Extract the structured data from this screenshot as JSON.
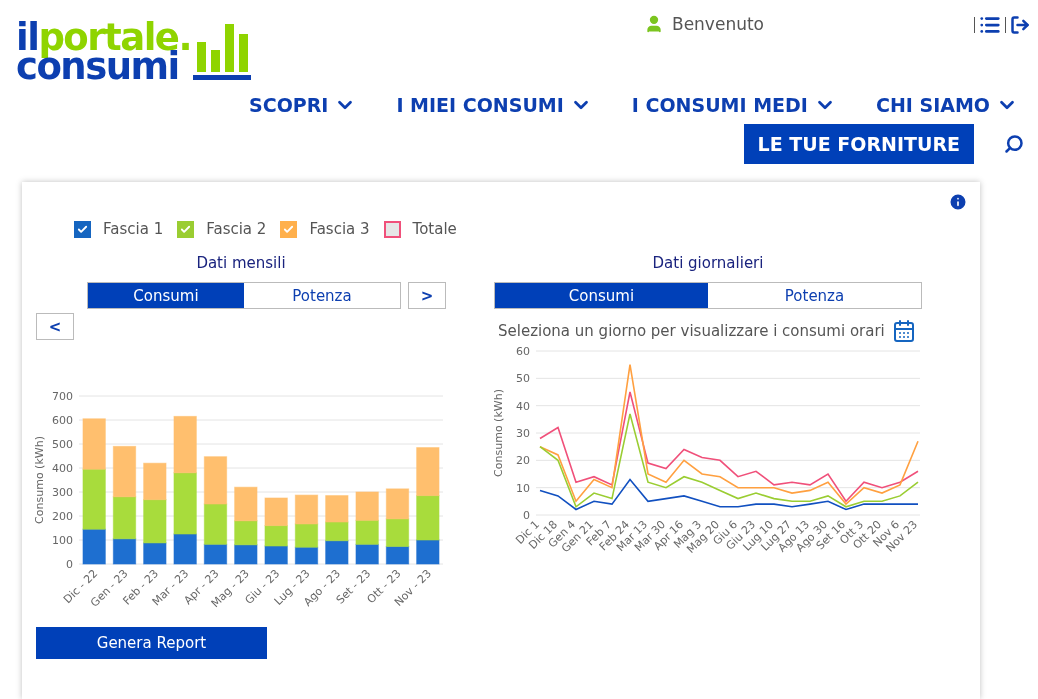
{
  "logo": {
    "part1": "il",
    "part2": "portale.",
    "part3": "consumi"
  },
  "user": {
    "greeting": "Benvenuto"
  },
  "nav": [
    {
      "label": "SCOPRI"
    },
    {
      "label": "I MIEI CONSUMI"
    },
    {
      "label": "I CONSUMI MEDI"
    },
    {
      "label": "CHI SIAMO"
    }
  ],
  "supply_button": "LE TUE FORNITURE",
  "legend": [
    {
      "label": "Fascia 1",
      "checked": true,
      "color": "#1565c0"
    },
    {
      "label": "Fascia 2",
      "checked": true,
      "color": "#9acd32"
    },
    {
      "label": "Fascia 3",
      "checked": true,
      "color": "#ffb04c"
    },
    {
      "label": "Totale",
      "checked": false,
      "color": "#f0507a"
    }
  ],
  "monthly": {
    "title": "Dati mensili",
    "prev": "<",
    "next": ">",
    "tabs": [
      {
        "label": "Consumi",
        "selected": true
      },
      {
        "label": "Potenza",
        "selected": false
      }
    ],
    "chart_data": {
      "type": "bar",
      "stacked": true,
      "grid": true,
      "ylabel": "Consumo (kWh)",
      "ylim": [
        0,
        700
      ],
      "yticks": [
        0,
        100,
        200,
        300,
        400,
        500,
        600,
        700
      ],
      "categories": [
        "Dic - 22",
        "Gen - 23",
        "Feb - 23",
        "Mar - 23",
        "Apr - 23",
        "Mag - 23",
        "Giu - 23",
        "Lug - 23",
        "Ago - 23",
        "Set - 23",
        "Ott - 23",
        "Nov - 23"
      ],
      "series": [
        {
          "color": "#1e6fd0",
          "values": [
            145,
            105,
            88,
            125,
            82,
            80,
            75,
            70,
            97,
            82,
            73,
            100
          ]
        },
        {
          "color": "#a8dc3c",
          "values": [
            250,
            175,
            180,
            255,
            168,
            100,
            85,
            97,
            78,
            100,
            115,
            185
          ]
        },
        {
          "color": "#ffbf6e",
          "values": [
            210,
            210,
            152,
            235,
            197,
            140,
            115,
            120,
            110,
            118,
            125,
            200
          ]
        }
      ]
    }
  },
  "daily": {
    "title": "Dati giornalieri",
    "tabs": [
      {
        "label": "Consumi",
        "selected": true
      },
      {
        "label": "Potenza",
        "selected": false
      }
    ],
    "hint": "Seleziona un giorno per visualizzare i consumi orari",
    "chart_data": {
      "type": "line",
      "grid": true,
      "ylabel": "Consumo (kWh)",
      "ylim": [
        0,
        60
      ],
      "yticks": [
        0,
        10,
        20,
        30,
        40,
        50,
        60
      ],
      "categories": [
        "Dic 1",
        "Dic 18",
        "Gen 4",
        "Gen 21",
        "Feb 7",
        "Feb 24",
        "Mar 13",
        "Mar 30",
        "Apr 16",
        "Mag 3",
        "Mag 20",
        "Giu 6",
        "Giu 23",
        "Lug 10",
        "Lug 27",
        "Ago 13",
        "Ago 30",
        "Set 16",
        "Ott 3",
        "Ott 20",
        "Nov 6",
        "Nov 23"
      ],
      "series": [
        {
          "color": "#f0507a",
          "values": [
            28,
            32,
            12,
            14,
            11,
            45,
            19,
            17,
            24,
            21,
            20,
            14,
            16,
            11,
            12,
            11,
            15,
            5,
            12,
            10,
            12,
            16
          ]
        },
        {
          "color": "#ffa040",
          "values": [
            25,
            22,
            5,
            13,
            10,
            55,
            15,
            12,
            20,
            15,
            14,
            10,
            10,
            10,
            8,
            9,
            12,
            4,
            10,
            8,
            11,
            27
          ]
        },
        {
          "color": "#9acd32",
          "values": [
            25,
            20,
            3,
            8,
            6,
            37,
            12,
            10,
            14,
            12,
            9,
            6,
            8,
            6,
            5,
            5,
            7,
            3,
            5,
            5,
            7,
            12
          ]
        },
        {
          "color": "#1150c0",
          "values": [
            9,
            7,
            2,
            5,
            4,
            13,
            5,
            6,
            7,
            5,
            3,
            3,
            4,
            4,
            3,
            4,
            5,
            2,
            4,
            4,
            4,
            4
          ]
        }
      ]
    }
  },
  "report_button": "Genera Report"
}
